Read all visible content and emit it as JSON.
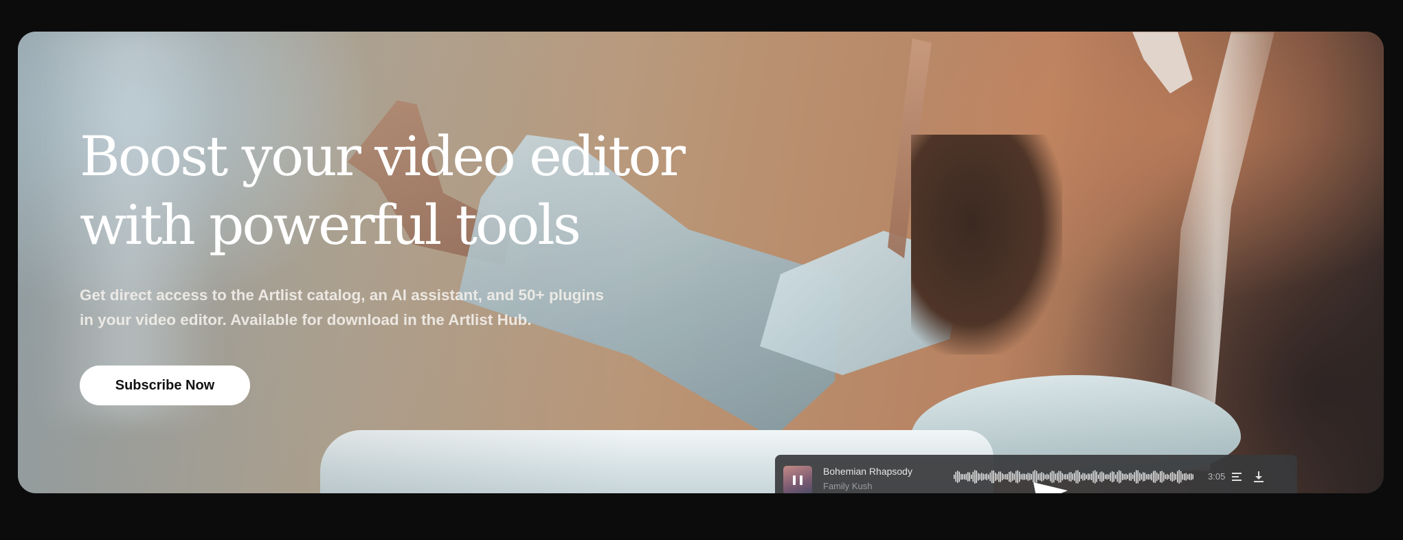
{
  "hero": {
    "headline_line1": "Boost your video editor",
    "headline_line2": "with powerful tools",
    "subtext_line1": "Get direct access to the Artlist catalog, an AI assistant, and 50+ plugins",
    "subtext_line2": "in your video editor. Available for download in the Artlist Hub.",
    "cta_label": "Subscribe Now"
  },
  "player": {
    "track_title": "Bohemian Rhapsody",
    "artist": "Family Kush",
    "duration": "3:05",
    "icons": [
      "pause-icon",
      "queue-icon",
      "download-icon"
    ]
  },
  "colors": {
    "page_background": "#0c0c0d",
    "cta_background": "#ffffff",
    "headline_text": "#ffffff",
    "player_background": "#383a3c"
  }
}
